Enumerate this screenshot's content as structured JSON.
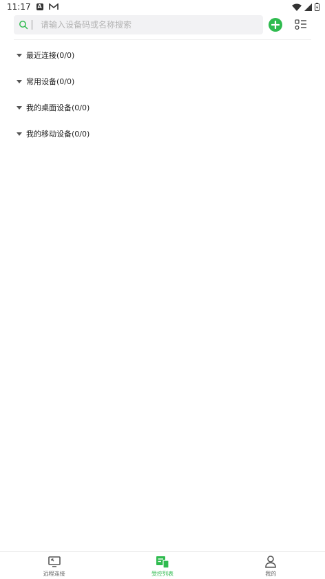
{
  "status_bar": {
    "time": "11:17",
    "badge_a": "A",
    "icons": [
      "notification-a-icon",
      "gmail-icon",
      "wifi-icon",
      "signal-icon",
      "battery-icon"
    ]
  },
  "search": {
    "placeholder": "请输入设备码或名称搜索",
    "value": ""
  },
  "toolbar": {
    "add_icon": "plus-icon",
    "list_icon": "list-view-icon"
  },
  "groups": [
    {
      "label": "最近连接(0/0)"
    },
    {
      "label": "常用设备(0/0)"
    },
    {
      "label": "我的桌面设备(0/0)"
    },
    {
      "label": "我的移动设备(0/0)"
    }
  ],
  "bottom_nav": {
    "items": [
      {
        "label": "远程连接",
        "icon": "monitor-icon",
        "active": false
      },
      {
        "label": "受控列表",
        "icon": "device-list-icon",
        "active": true
      },
      {
        "label": "我的",
        "icon": "person-icon",
        "active": false
      }
    ]
  },
  "colors": {
    "accent": "#2fbb4f",
    "search_bg": "#f2f2f4",
    "text": "#222222",
    "placeholder": "#b3b3b3"
  }
}
